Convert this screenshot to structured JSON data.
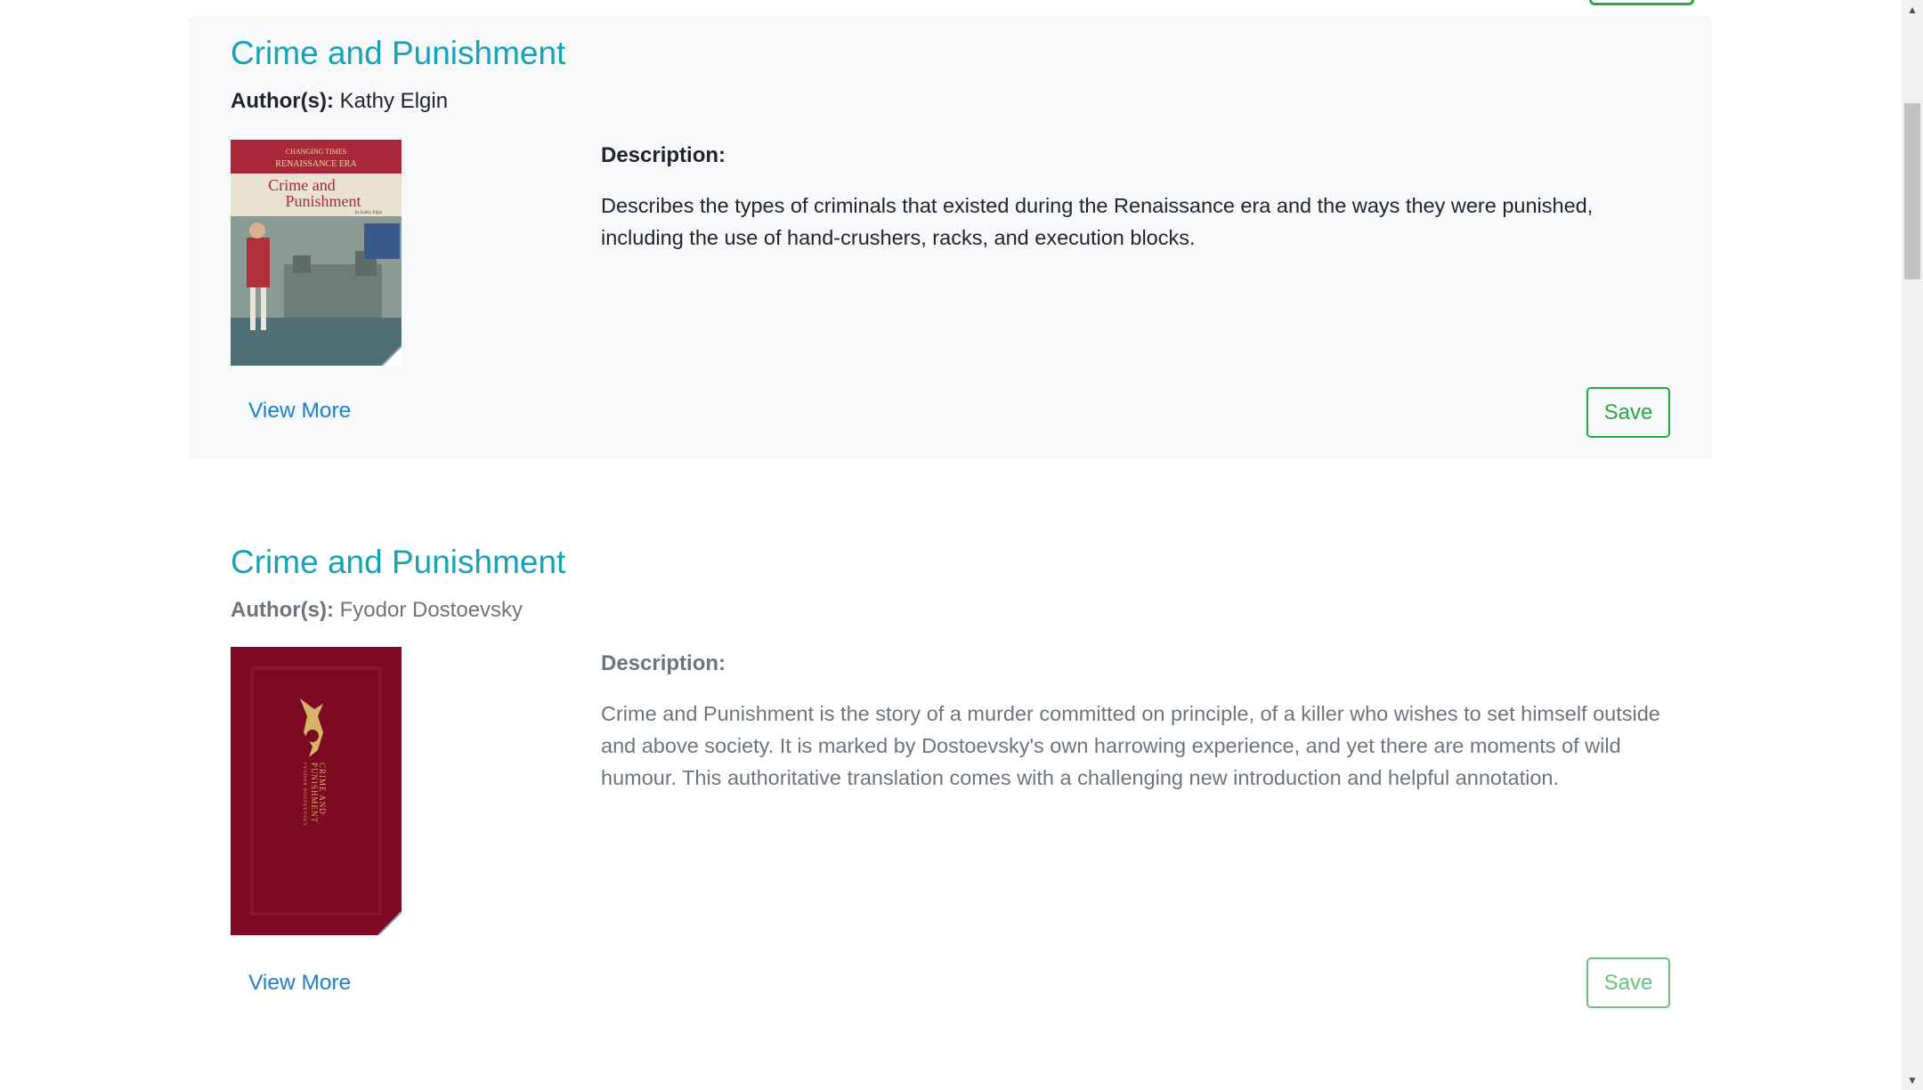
{
  "books": [
    {
      "title": "Crime and Punishment",
      "authors_label": "Author(s):",
      "authors": "Kathy Elgin",
      "cover": {
        "series_line1": "CHANGING TIMES",
        "series_line2": "RENAISSANCE ERA",
        "title_line1": "Crime and",
        "title_line2": "Punishment",
        "byline": "by Kathy Elgin"
      },
      "description_label": "Description:",
      "description": "Describes the types of criminals that existed during the Renaissance era and the ways they were punished, including the use of hand-crushers, racks, and execution blocks.",
      "view_more": "View More",
      "save": "Save"
    },
    {
      "title": "Crime and Punishment",
      "authors_label": "Author(s):",
      "authors": "Fyodor Dostoevsky",
      "cover": {
        "title_line1": "CRIME AND",
        "title_line2": "PUNISHMENT",
        "byline": "FYODOR DOSTOEVSKY"
      },
      "description_label": "Description:",
      "description": "Crime and Punishment is the story of a murder committed on principle, of a killer who wishes to set himself outside and above society. It is marked by Dostoevsky's own harrowing experience, and yet there are moments of wild humour. This authoritative translation comes with a challenging new introduction and helpful annotation.",
      "view_more": "View More",
      "save": "Save"
    }
  ],
  "colors": {
    "title": "#17a2b8",
    "link": "#1a7fd4",
    "save": "#28a745",
    "card_bg": "#f7f8fa",
    "muted_text": "#6c757d"
  },
  "icons": {
    "scroll_up": "triangle-up",
    "scroll_down": "triangle-down"
  }
}
